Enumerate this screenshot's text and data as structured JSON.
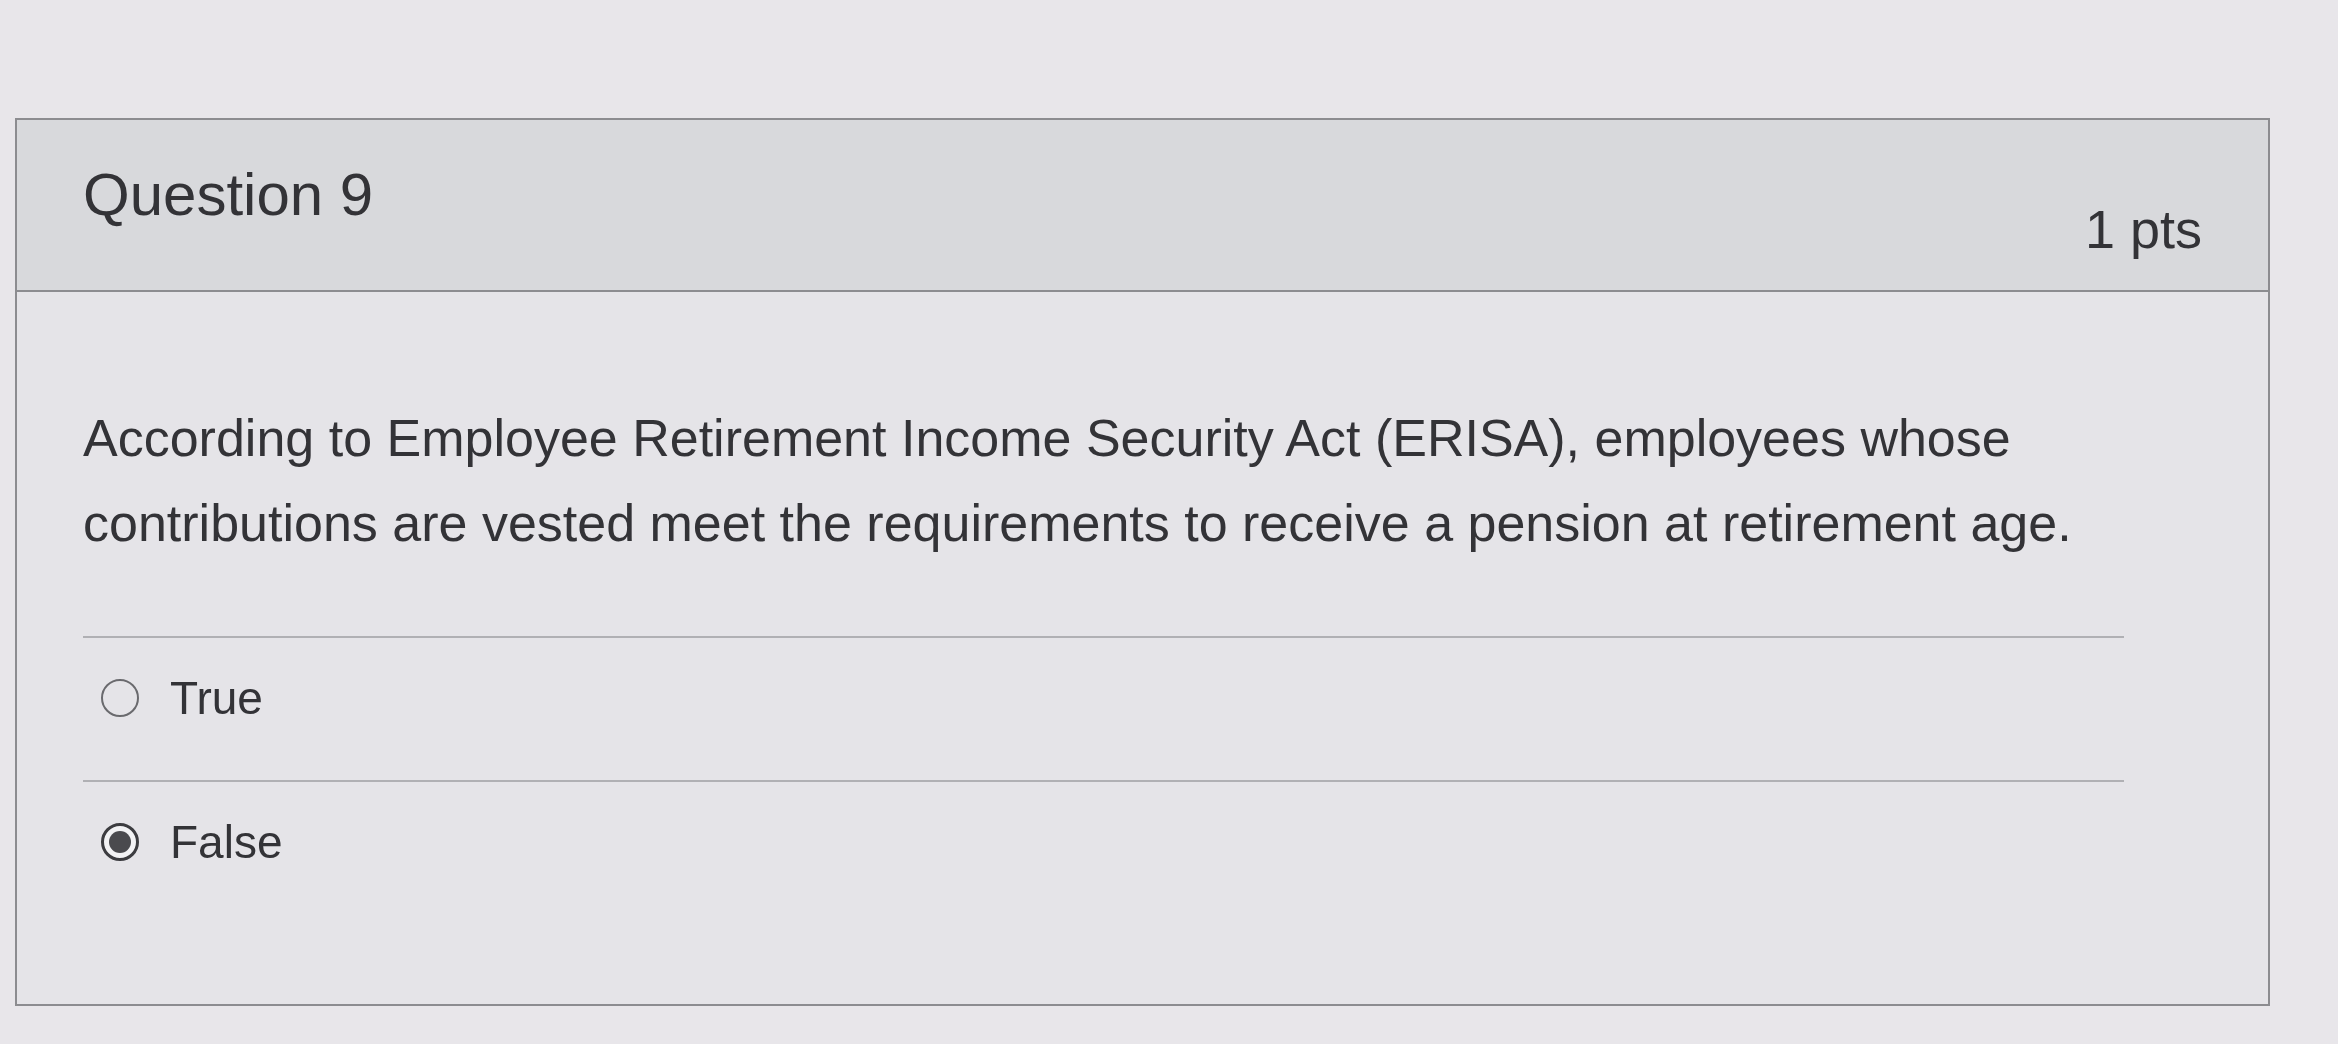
{
  "question": {
    "title": "Question 9",
    "points": "1 pts",
    "text": "According to Employee Retirement Income Security Act (ERISA), employees whose contributions are vested meet the requirements to receive a pension at retirement age.",
    "answers": [
      {
        "label": "True",
        "selected": false
      },
      {
        "label": "False",
        "selected": true
      }
    ]
  }
}
